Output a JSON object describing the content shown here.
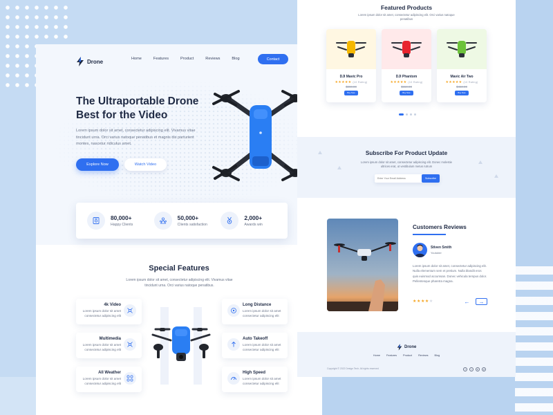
{
  "landing": {
    "brand": "Drone",
    "nav": [
      "Home",
      "Features",
      "Product",
      "Reviews",
      "Blog"
    ],
    "contact_label": "Contact",
    "hero": {
      "title": "The Ultraportable Drone Best for the Video",
      "description": "Lorem ipsum dolor sit amet, consectetur adipiscing elit. Vivamus vitae tincidunt urna. Orci varius natoque penatibus et magnis dis parturient montes, nascetur ridiculus amet.",
      "primary_cta": "Explore Now",
      "secondary_cta": "Watch Video"
    },
    "stats": [
      {
        "value": "80,000+",
        "label": "Happy Clients",
        "icon": "certificate-icon"
      },
      {
        "value": "50,000+",
        "label": "Clients satisfaction",
        "icon": "people-icon"
      },
      {
        "value": "2,000+",
        "label": "Awards win",
        "icon": "medal-icon"
      }
    ],
    "features_section": {
      "title": "Special Features",
      "description": "Lorem ipsum dolor sit amet, consectetur adipiscing elit. Vivamus vitae tincidunt urna. Orci varius natoque penatibus.",
      "left": [
        {
          "title": "4k Video",
          "description": "Lorem ipsum dolor sit amet consectetur adipiscing elit",
          "icon": "drone-icon"
        },
        {
          "title": "Multimedia",
          "description": "Lorem ipsum dolor sit amet consectetur adipiscing elit",
          "icon": "drone-icon"
        },
        {
          "title": "All Weather",
          "description": "Lorem ipsum dolor sit amet consectetur adipiscing elit",
          "icon": "propeller-icon"
        }
      ],
      "right": [
        {
          "title": "Long Distance",
          "description": "Lorem ipsum dolor sit amet consectetur adipiscing elit",
          "icon": "signal-icon"
        },
        {
          "title": "Auto Takeoff",
          "description": "Lorem ipsum dolor sit amet consectetur adipiscing elit",
          "icon": "takeoff-icon"
        },
        {
          "title": "High Speed",
          "description": "Lorem ipsum dolor sit amet consectetur adipiscing elit",
          "icon": "speed-icon"
        }
      ]
    }
  },
  "shop": {
    "featured": {
      "title": "Featured Products",
      "description": "Lorem ipsum dolor sit amet, consectetur adipiscing elit. Orci varius natoque penatibus",
      "products": [
        {
          "name": "DJI Mavic Pro",
          "stars": "★★★★★",
          "reviews": "(10 Rating)",
          "price": "$890.00",
          "button": "Buy Now",
          "color": "#f5b800",
          "bg": "#fff7e2"
        },
        {
          "name": "DJI Phantom",
          "stars": "★★★★★",
          "reviews": "(10 Rating)",
          "price": "$650.00",
          "button": "Buy Now",
          "color": "#e8242e",
          "bg": "#ffe9ea"
        },
        {
          "name": "Mavic Air Two",
          "stars": "★★★★★",
          "reviews": "(10 Rating)",
          "price": "$450.00",
          "button": "Buy Now",
          "color": "#6cc23a",
          "bg": "#eef9e4"
        }
      ]
    },
    "subscribe": {
      "title": "Subscribe For Product Update",
      "description": "Lorem ipsum dolor sit amet, consectetur adipiscing elit. Donec molestie ultrices erat, ut vestibulum metus rutrum",
      "placeholder": "Enter Your Email Address",
      "button": "Subscribe"
    },
    "reviews": {
      "title": "Customers Reviews",
      "name": "Stiven Smith",
      "role": "Youtuber",
      "text": "Lorem ipsum dolor sit amet, consectetur adipiscing elit. Nulla elementum sem et pretium. Nulla blandit eros quis euismod accumsan. Donec vehicula tempus dolor. Pellentesque pharetra magna.",
      "rating_on": "★★★★",
      "rating_off": "★",
      "prev": "←",
      "next": "→"
    },
    "footer": {
      "brand": "Drone",
      "nav": [
        "Home",
        "Features",
        "Product",
        "Reviews",
        "Blog"
      ],
      "copyright": "Copyright © 2022 Design Tech. All rights reserved",
      "social": [
        "f",
        "t",
        "in",
        "yt"
      ]
    }
  },
  "colors": {
    "accent": "#2f6ff0",
    "drone_blue": "#2a7ef3",
    "background": "#c5dbf3"
  }
}
